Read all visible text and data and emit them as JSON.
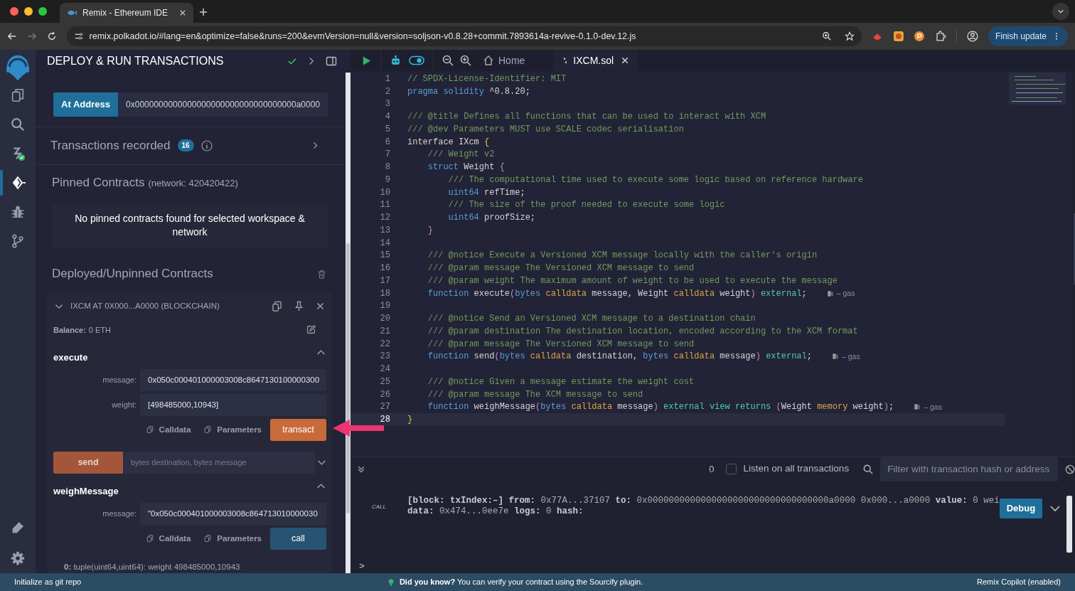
{
  "browser": {
    "tab_title": "Remix - Ethereum IDE",
    "url": "remix.polkadot.io/#lang=en&optimize=false&runs=200&evmVersion=null&version=soljson-v0.8.28+commit.7893614a-revive-0.1.0-dev.12.js",
    "update_button": "Finish update"
  },
  "rail": {
    "top": [
      {
        "kind": "files",
        "selected": false
      },
      {
        "kind": "search",
        "selected": false
      },
      {
        "kind": "compiler",
        "selected": false
      },
      {
        "kind": "deploy",
        "selected": true
      },
      {
        "kind": "debugger",
        "selected": false
      },
      {
        "kind": "git",
        "selected": false
      }
    ],
    "bottom": [
      {
        "kind": "plugins",
        "selected": false
      },
      {
        "kind": "settings",
        "selected": false
      }
    ]
  },
  "panel": {
    "title": "DEPLOY & RUN TRANSACTIONS",
    "at_address": {
      "button": "At Address",
      "value": "0x0000000000000000000000000000000000a0000"
    },
    "transactions_recorded": {
      "label": "Transactions recorded",
      "count": "16",
      "expanded": false
    },
    "pinned": {
      "title": "Pinned Contracts",
      "network": "(network: 420420422)",
      "empty_message": "No pinned contracts found for selected workspace & network"
    },
    "deployed": {
      "title": "Deployed/Unpinned Contracts",
      "instance": {
        "title": "IXCM AT 0X000...A0000 (BLOCKCHAIN)",
        "expanded": true,
        "balance_label": "Balance:",
        "balance": "0 ETH",
        "functions": [
          {
            "name": "execute",
            "kind": "transact",
            "expanded": true,
            "inputs": [
              {
                "label": "message:",
                "value": "0x050c000401000003008c8647130100000300"
              },
              {
                "label": "weight:",
                "value": "[498485000,10943]"
              }
            ],
            "calldata": "Calldata",
            "parameters": "Parameters",
            "button": "transact"
          },
          {
            "kind": "transact",
            "expanded": false,
            "placeholder": "bytes destination, bytes message",
            "button": "send"
          },
          {
            "name": "weighMessage",
            "kind": "call",
            "expanded": true,
            "inputs": [
              {
                "label": "message:",
                "value": "\"0x050c000401000003008c864713010000030"
              }
            ],
            "calldata": "Calldata",
            "parameters": "Parameters",
            "button": "call",
            "output": "**0:** tuple(uint64,uint64): weight 498485000,10943"
          }
        ]
      }
    }
  },
  "editor": {
    "toggle_on": true,
    "tabs": [
      {
        "label": "Home",
        "kind": "home",
        "selected": false
      },
      {
        "label": "IXCM.sol",
        "kind": "file",
        "selected": true
      }
    ],
    "lines": [
      {
        "number": "1",
        "active": false,
        "tokens": [
          {
            "kind": "comment",
            "text": "// SPDX-License-Identifier: MIT"
          }
        ]
      },
      {
        "number": "2",
        "active": false,
        "tokens": [
          {
            "kind": "keyword",
            "text": "pragma solidity"
          },
          {
            "kind": "plain",
            "text": " ^0.8.20;"
          }
        ]
      },
      {
        "number": "3",
        "active": false
      },
      {
        "number": "4",
        "active": false,
        "tokens": [
          {
            "kind": "comment",
            "text": "/// @title Defines all functions that can be used to interact with XCM"
          }
        ]
      },
      {
        "number": "5",
        "active": false,
        "tokens": [
          {
            "kind": "comment",
            "text": "/// @dev Parameters MUST use SCALE codec serialisation"
          }
        ]
      },
      {
        "number": "6",
        "active": false,
        "tokens": [
          {
            "kind": "plain",
            "text": "interface IXcm "
          },
          {
            "kind": "brace",
            "text": "{"
          }
        ]
      },
      {
        "number": "7",
        "active": false,
        "tokens": [
          {
            "kind": "comment",
            "text": "    /// Weight v2"
          }
        ]
      },
      {
        "number": "8",
        "active": false,
        "tokens": [
          {
            "kind": "keyword",
            "text": "    struct"
          },
          {
            "kind": "plain",
            "text": " Weight "
          },
          {
            "kind": "bracket",
            "text": "{"
          }
        ]
      },
      {
        "number": "9",
        "active": false,
        "tokens": [
          {
            "kind": "comment",
            "text": "        /// The computational time used to execute some logic based on reference hardware"
          }
        ]
      },
      {
        "number": "10",
        "active": false,
        "tokens": [
          {
            "kind": "keyword",
            "text": "        uint64"
          },
          {
            "kind": "plain",
            "text": " refTime;"
          }
        ]
      },
      {
        "number": "11",
        "active": false,
        "tokens": [
          {
            "kind": "comment",
            "text": "        /// The size of the proof needed to execute some logic"
          }
        ]
      },
      {
        "number": "12",
        "active": false,
        "tokens": [
          {
            "kind": "keyword",
            "text": "        uint64"
          },
          {
            "kind": "plain",
            "text": " proofSize;"
          }
        ]
      },
      {
        "number": "13",
        "active": false,
        "tokens": [
          {
            "kind": "bracket",
            "text": "    }"
          }
        ]
      },
      {
        "number": "14",
        "active": false
      },
      {
        "number": "15",
        "active": false,
        "tokens": [
          {
            "kind": "comment",
            "text": "    /// @notice Execute a Versioned XCM message locally with the caller's origin"
          }
        ]
      },
      {
        "number": "16",
        "active": false,
        "tokens": [
          {
            "kind": "comment",
            "text": "    /// @param message The Versioned XCM message to send"
          }
        ]
      },
      {
        "number": "17",
        "active": false,
        "tokens": [
          {
            "kind": "comment",
            "text": "    /// @param weight The maximum amount of weight to be used to execute the message"
          }
        ]
      },
      {
        "number": "18",
        "active": false,
        "gas": "– gas",
        "tokens": [
          {
            "kind": "keyword",
            "text": "    function"
          },
          {
            "kind": "plain",
            "text": " execute"
          },
          {
            "kind": "bracket",
            "text": "("
          },
          {
            "kind": "keyword",
            "text": "bytes"
          },
          {
            "kind": "storage",
            "text": " calldata"
          },
          {
            "kind": "plain",
            "text": " message, Weight"
          },
          {
            "kind": "storage",
            "text": " calldata"
          },
          {
            "kind": "plain",
            "text": " weight"
          },
          {
            "kind": "bracket",
            "text": ")"
          },
          {
            "kind": "modifier",
            "text": " external"
          },
          {
            "kind": "plain",
            "text": ";"
          }
        ]
      },
      {
        "number": "19",
        "active": false
      },
      {
        "number": "20",
        "active": false,
        "tokens": [
          {
            "kind": "comment",
            "text": "    /// @notice Send an Versioned XCM message to a destination chain"
          }
        ]
      },
      {
        "number": "21",
        "active": false,
        "tokens": [
          {
            "kind": "comment",
            "text": "    /// @param destination The destination location, encoded according to the XCM format"
          }
        ]
      },
      {
        "number": "22",
        "active": false,
        "tokens": [
          {
            "kind": "comment",
            "text": "    /// @param message The Versioned XCM message to send"
          }
        ]
      },
      {
        "number": "23",
        "active": false,
        "gas": "– gas",
        "tokens": [
          {
            "kind": "keyword",
            "text": "    function"
          },
          {
            "kind": "plain",
            "text": " send"
          },
          {
            "kind": "bracket",
            "text": "("
          },
          {
            "kind": "keyword",
            "text": "bytes"
          },
          {
            "kind": "storage",
            "text": " calldata"
          },
          {
            "kind": "plain",
            "text": " destination, "
          },
          {
            "kind": "keyword",
            "text": "bytes"
          },
          {
            "kind": "storage",
            "text": " calldata"
          },
          {
            "kind": "plain",
            "text": " message"
          },
          {
            "kind": "bracket",
            "text": ")"
          },
          {
            "kind": "modifier",
            "text": " external"
          },
          {
            "kind": "plain",
            "text": ";"
          }
        ]
      },
      {
        "number": "24",
        "active": false
      },
      {
        "number": "25",
        "active": false,
        "tokens": [
          {
            "kind": "comment",
            "text": "    /// @notice Given a message estimate the weight cost"
          }
        ]
      },
      {
        "number": "26",
        "active": false,
        "tokens": [
          {
            "kind": "comment",
            "text": "    /// @param message The XCM message to send"
          }
        ]
      },
      {
        "number": "27",
        "active": false,
        "gas": "– gas",
        "tokens": [
          {
            "kind": "keyword",
            "text": "    function"
          },
          {
            "kind": "plain",
            "text": " weighMessage"
          },
          {
            "kind": "bracket",
            "text": "("
          },
          {
            "kind": "keyword",
            "text": "bytes"
          },
          {
            "kind": "storage",
            "text": " calldata"
          },
          {
            "kind": "plain",
            "text": " message"
          },
          {
            "kind": "bracket",
            "text": ")"
          },
          {
            "kind": "modifier",
            "text": " external view returns"
          },
          {
            "kind": "bracket",
            "text": " ("
          },
          {
            "kind": "plain",
            "text": "Weight"
          },
          {
            "kind": "storage",
            "text": " memory"
          },
          {
            "kind": "plain",
            "text": " weight"
          },
          {
            "kind": "bracket",
            "text": ")"
          },
          {
            "kind": "plain",
            "text": ";"
          }
        ]
      },
      {
        "number": "28",
        "active": true,
        "tokens": [
          {
            "kind": "brace",
            "text": "}"
          }
        ]
      }
    ]
  },
  "terminal": {
    "count": "0",
    "listen": {
      "label": "Listen on all transactions",
      "checked": false
    },
    "filter_placeholder": "Filter with transaction hash or address",
    "log": {
      "tag": "CALL",
      "lines": [
        "**[block: txIndex:–]  from:** 0x77A...37107 **to:** 0x0000000000000000000000000000000000a0000 0x000...a0000 **value:** 0 wei",
        "**data:** 0x474...0ee7e **logs:** 0 **hash:**"
      ],
      "button": "Debug"
    },
    "prompt": ">"
  },
  "status_bar": {
    "left": "Initialize as git repo",
    "tip": "**Did you know?**  You can verify your contract using the Sourcify plugin.",
    "right": "Remix Copilot (enabled)"
  }
}
